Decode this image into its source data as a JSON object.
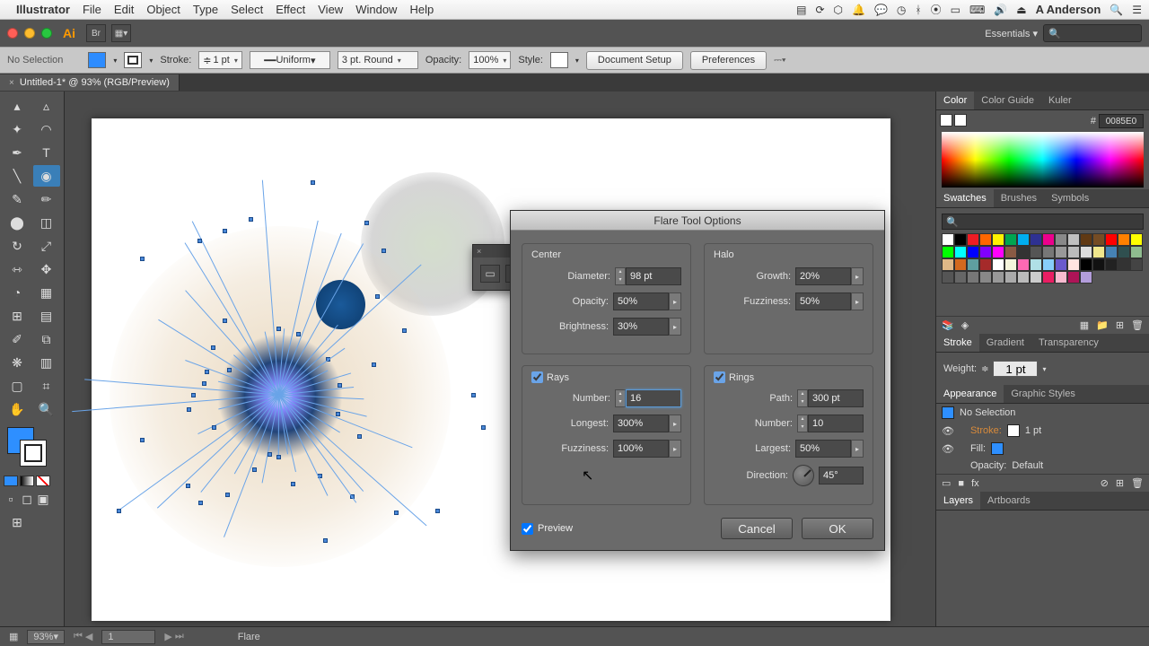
{
  "menubar": {
    "app": "Illustrator",
    "items": [
      "File",
      "Edit",
      "Object",
      "Type",
      "Select",
      "Effect",
      "View",
      "Window",
      "Help"
    ],
    "username": "A Anderson"
  },
  "workspace": {
    "name": "Essentials",
    "search_placeholder": ""
  },
  "controlbar": {
    "selection": "No Selection",
    "stroke_label": "Stroke:",
    "stroke_weight": "1 pt",
    "stroke_profile": "Uniform",
    "brush": "3 pt. Round",
    "opacity_label": "Opacity:",
    "opacity_value": "100%",
    "style_label": "Style:",
    "doc_setup": "Document Setup",
    "prefs": "Preferences"
  },
  "document": {
    "tab": "Untitled-1* @ 93% (RGB/Preview)"
  },
  "panels": {
    "color": {
      "tabs": [
        "Color",
        "Color Guide",
        "Kuler"
      ],
      "hex": "0085E0"
    },
    "swatches": {
      "tabs": [
        "Swatches",
        "Brushes",
        "Symbols"
      ]
    },
    "stroke": {
      "tabs": [
        "Stroke",
        "Gradient",
        "Transparency"
      ],
      "weight_label": "Weight:",
      "weight": "1 pt"
    },
    "appearance": {
      "tabs": [
        "Appearance",
        "Graphic Styles"
      ],
      "selection": "No Selection",
      "stroke_label": "Stroke:",
      "stroke_val": "1 pt",
      "fill_label": "Fill:",
      "opacity_label": "Opacity:",
      "opacity_val": "Default"
    },
    "layers": {
      "tabs": [
        "Layers",
        "Artboards"
      ]
    }
  },
  "dialog": {
    "title": "Flare Tool Options",
    "center": {
      "label": "Center",
      "diameter_label": "Diameter:",
      "diameter": "98 pt",
      "opacity_label": "Opacity:",
      "opacity": "50%",
      "brightness_label": "Brightness:",
      "brightness": "30%"
    },
    "halo": {
      "label": "Halo",
      "growth_label": "Growth:",
      "growth": "20%",
      "fuzz_label": "Fuzziness:",
      "fuzz": "50%"
    },
    "rays": {
      "label": "Rays",
      "number_label": "Number:",
      "number": "16",
      "longest_label": "Longest:",
      "longest": "300%",
      "fuzz_label": "Fuzziness:",
      "fuzz": "100%"
    },
    "rings": {
      "label": "Rings",
      "path_label": "Path:",
      "path": "300 pt",
      "number_label": "Number:",
      "number": "10",
      "largest_label": "Largest:",
      "largest": "50%",
      "dir_label": "Direction:",
      "dir": "45°"
    },
    "preview": "Preview",
    "cancel": "Cancel",
    "ok": "OK"
  },
  "statusbar": {
    "zoom": "93%",
    "page": "1",
    "tool": "Flare"
  },
  "swatch_colors": [
    "#ffffff",
    "#000000",
    "#ed1c24",
    "#ff6600",
    "#fff200",
    "#00a651",
    "#00aeef",
    "#2e3192",
    "#ec008c",
    "#898989",
    "#c0c0c0",
    "#603913",
    "#754c24",
    "#ff0000",
    "#ff8000",
    "#ffff00",
    "#00ff00",
    "#00ffff",
    "#0000ff",
    "#8000ff",
    "#ff00ff",
    "#8a5a44",
    "#333333",
    "#555555",
    "#777777",
    "#999999",
    "#bbbbbb",
    "#dddddd",
    "#f0e68c",
    "#4682b4",
    "#2f4f4f",
    "#8fbc8f",
    "#deb887",
    "#d2691e",
    "#5f9ea0",
    "#a52a2a",
    "#ffffff",
    "#f5f5dc",
    "#ff69b4",
    "#b0e0e6",
    "#87cefa",
    "#6a5acd",
    "#ffe4e1",
    "#000",
    "#111",
    "#222",
    "#333",
    "#444",
    "#555",
    "#666",
    "#777",
    "#888",
    "#999",
    "#aaa",
    "#bbb",
    "#ccc",
    "#e91e63",
    "#f8bbd0",
    "#ad1457",
    "#b39ddb"
  ]
}
